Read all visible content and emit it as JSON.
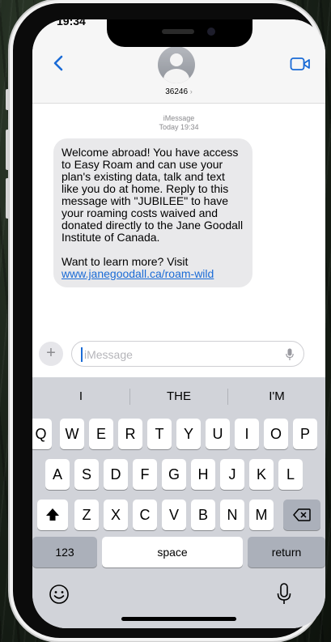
{
  "status_bar": {
    "time": "19:34"
  },
  "header": {
    "contact": "36246",
    "chevron": "›"
  },
  "thread": {
    "service": "iMessage",
    "timestamp": "Today 19:34"
  },
  "message": {
    "lines": [
      "Welcome abroad! You have access",
      "to Easy Roam and can use your",
      "plan's existing data, talk and text",
      "like you do at home. Reply to this",
      "message with \"JUBILEE\" to have",
      "your roaming costs waived and",
      "donated directly to the Jane Goodall",
      "Institute of Canada."
    ],
    "followup": "Want to learn more? Visit",
    "link": "www.janegoodall.ca/roam-wild"
  },
  "composer": {
    "plus": "+",
    "placeholder": "iMessage"
  },
  "suggestions": [
    "I",
    "THE",
    "I'M"
  ],
  "keyboard": {
    "row1": [
      "Q",
      "W",
      "E",
      "R",
      "T",
      "Y",
      "U",
      "I",
      "O",
      "P"
    ],
    "row2": [
      "A",
      "S",
      "D",
      "F",
      "G",
      "H",
      "J",
      "K",
      "L"
    ],
    "row3": [
      "Z",
      "X",
      "C",
      "V",
      "B",
      "N",
      "M"
    ],
    "numbers_label": "123",
    "space_label": "space",
    "return_label": "return"
  },
  "icons": [
    "back-icon",
    "video-icon",
    "avatar",
    "plus-icon",
    "mic-icon",
    "shift-icon",
    "delete-icon",
    "emoji-icon",
    "dictation-icon"
  ],
  "colors": {
    "accent": "#1a6bd6",
    "bubble": "#e9e9eb",
    "keyboard": "#d1d3d9"
  }
}
